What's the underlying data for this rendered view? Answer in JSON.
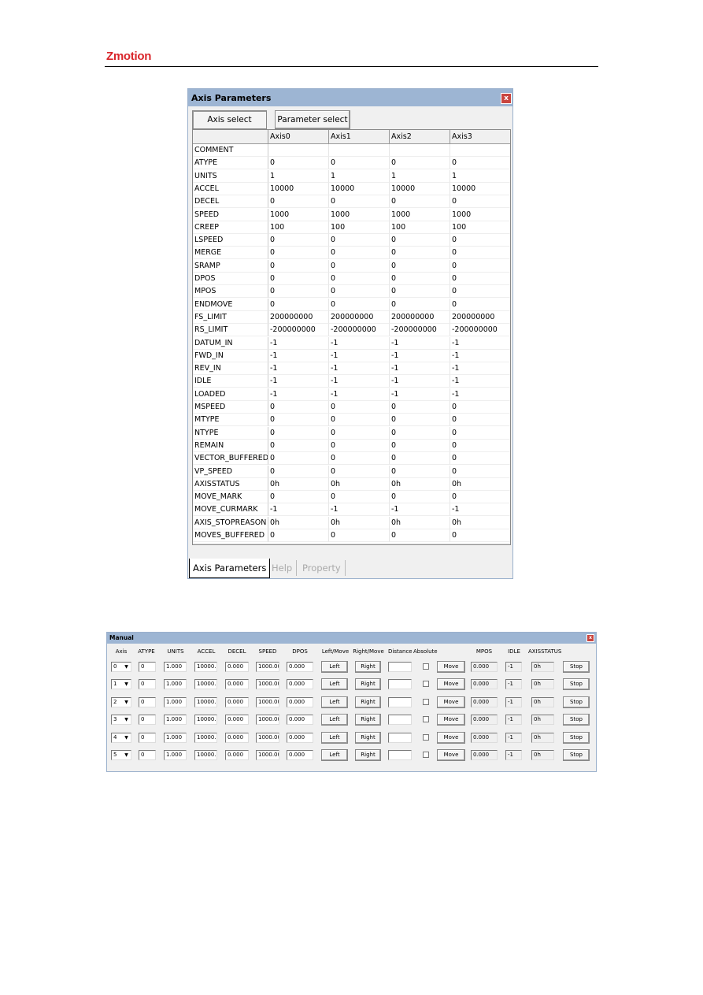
{
  "header": {
    "logo": "Zmotion"
  },
  "axis_panel": {
    "title": "Axis Parameters",
    "close_icon": "close-icon",
    "buttons": [
      "Axis select",
      "Parameter select"
    ],
    "columns": [
      "",
      "Axis0",
      "Axis1",
      "Axis2",
      "Axis3"
    ],
    "rows": [
      [
        "COMMENT",
        "",
        "",
        "",
        ""
      ],
      [
        "ATYPE",
        "0",
        "0",
        "0",
        "0"
      ],
      [
        "UNITS",
        "1",
        "1",
        "1",
        "1"
      ],
      [
        "ACCEL",
        "10000",
        "10000",
        "10000",
        "10000"
      ],
      [
        "DECEL",
        "0",
        "0",
        "0",
        "0"
      ],
      [
        "SPEED",
        "1000",
        "1000",
        "1000",
        "1000"
      ],
      [
        "CREEP",
        "100",
        "100",
        "100",
        "100"
      ],
      [
        "LSPEED",
        "0",
        "0",
        "0",
        "0"
      ],
      [
        "MERGE",
        "0",
        "0",
        "0",
        "0"
      ],
      [
        "SRAMP",
        "0",
        "0",
        "0",
        "0"
      ],
      [
        "DPOS",
        "0",
        "0",
        "0",
        "0"
      ],
      [
        "MPOS",
        "0",
        "0",
        "0",
        "0"
      ],
      [
        "ENDMOVE",
        "0",
        "0",
        "0",
        "0"
      ],
      [
        "FS_LIMIT",
        "200000000",
        "200000000",
        "200000000",
        "200000000"
      ],
      [
        "RS_LIMIT",
        "-200000000",
        "-200000000",
        "-200000000",
        "-200000000"
      ],
      [
        "DATUM_IN",
        "-1",
        "-1",
        "-1",
        "-1"
      ],
      [
        "FWD_IN",
        "-1",
        "-1",
        "-1",
        "-1"
      ],
      [
        "REV_IN",
        "-1",
        "-1",
        "-1",
        "-1"
      ],
      [
        "IDLE",
        "-1",
        "-1",
        "-1",
        "-1"
      ],
      [
        "LOADED",
        "-1",
        "-1",
        "-1",
        "-1"
      ],
      [
        "MSPEED",
        "0",
        "0",
        "0",
        "0"
      ],
      [
        "MTYPE",
        "0",
        "0",
        "0",
        "0"
      ],
      [
        "NTYPE",
        "0",
        "0",
        "0",
        "0"
      ],
      [
        "REMAIN",
        "0",
        "0",
        "0",
        "0"
      ],
      [
        "VECTOR_BUFFERED",
        "0",
        "0",
        "0",
        "0"
      ],
      [
        "VP_SPEED",
        "0",
        "0",
        "0",
        "0"
      ],
      [
        "AXISSTATUS",
        "0h",
        "0h",
        "0h",
        "0h"
      ],
      [
        "MOVE_MARK",
        "0",
        "0",
        "0",
        "0"
      ],
      [
        "MOVE_CURMARK",
        "-1",
        "-1",
        "-1",
        "-1"
      ],
      [
        "AXIS_STOPREASON",
        "0h",
        "0h",
        "0h",
        "0h"
      ],
      [
        "MOVES_BUFFERED",
        "0",
        "0",
        "0",
        "0"
      ]
    ],
    "scroll_left": "<",
    "scroll_right": ">",
    "tabs": [
      {
        "label": "Axis Parameters",
        "active": true
      },
      {
        "label": "Help",
        "active": false
      },
      {
        "label": "Property",
        "active": false
      }
    ]
  },
  "manual_panel": {
    "title": "Manual",
    "headers": [
      "Axis",
      "ATYPE",
      "UNITS",
      "ACCEL",
      "DECEL",
      "SPEED",
      "DPOS",
      "Left/Move",
      "Right/Move",
      "Distance",
      "Absolute",
      "MPOS",
      "IDLE",
      "AXISSTATUS"
    ],
    "rows": [
      {
        "axis": "0",
        "atype": "0",
        "units": "1.000",
        "accel": "10000.0",
        "decel": "0.000",
        "speed": "1000.00",
        "dpos": "0.000",
        "left": "Left",
        "right": "Right",
        "distance": "",
        "absolute": false,
        "move": "Move",
        "mpos": "0.000",
        "idle": "-1",
        "axisstatus": "0h",
        "stop": "Stop"
      },
      {
        "axis": "1",
        "atype": "0",
        "units": "1.000",
        "accel": "10000.0",
        "decel": "0.000",
        "speed": "1000.00",
        "dpos": "0.000",
        "left": "Left",
        "right": "Right",
        "distance": "",
        "absolute": false,
        "move": "Move",
        "mpos": "0.000",
        "idle": "-1",
        "axisstatus": "0h",
        "stop": "Stop"
      },
      {
        "axis": "2",
        "atype": "0",
        "units": "1.000",
        "accel": "10000.0",
        "decel": "0.000",
        "speed": "1000.00",
        "dpos": "0.000",
        "left": "Left",
        "right": "Right",
        "distance": "",
        "absolute": false,
        "move": "Move",
        "mpos": "0.000",
        "idle": "-1",
        "axisstatus": "0h",
        "stop": "Stop"
      },
      {
        "axis": "3",
        "atype": "0",
        "units": "1.000",
        "accel": "10000.0",
        "decel": "0.000",
        "speed": "1000.00",
        "dpos": "0.000",
        "left": "Left",
        "right": "Right",
        "distance": "",
        "absolute": false,
        "move": "Move",
        "mpos": "0.000",
        "idle": "-1",
        "axisstatus": "0h",
        "stop": "Stop"
      },
      {
        "axis": "4",
        "atype": "0",
        "units": "1.000",
        "accel": "10000.0",
        "decel": "0.000",
        "speed": "1000.00",
        "dpos": "0.000",
        "left": "Left",
        "right": "Right",
        "distance": "",
        "absolute": false,
        "move": "Move",
        "mpos": "0.000",
        "idle": "-1",
        "axisstatus": "0h",
        "stop": "Stop"
      },
      {
        "axis": "5",
        "atype": "0",
        "units": "1.000",
        "accel": "10000.0",
        "decel": "0.000",
        "speed": "1000.00",
        "dpos": "0.000",
        "left": "Left",
        "right": "Right",
        "distance": "",
        "absolute": false,
        "move": "Move",
        "mpos": "0.000",
        "idle": "-1",
        "axisstatus": "0h",
        "stop": "Stop"
      }
    ]
  },
  "colors": {
    "brand": "#d9262b",
    "title_bar": "#9db5d3",
    "close": "#c9453f"
  }
}
